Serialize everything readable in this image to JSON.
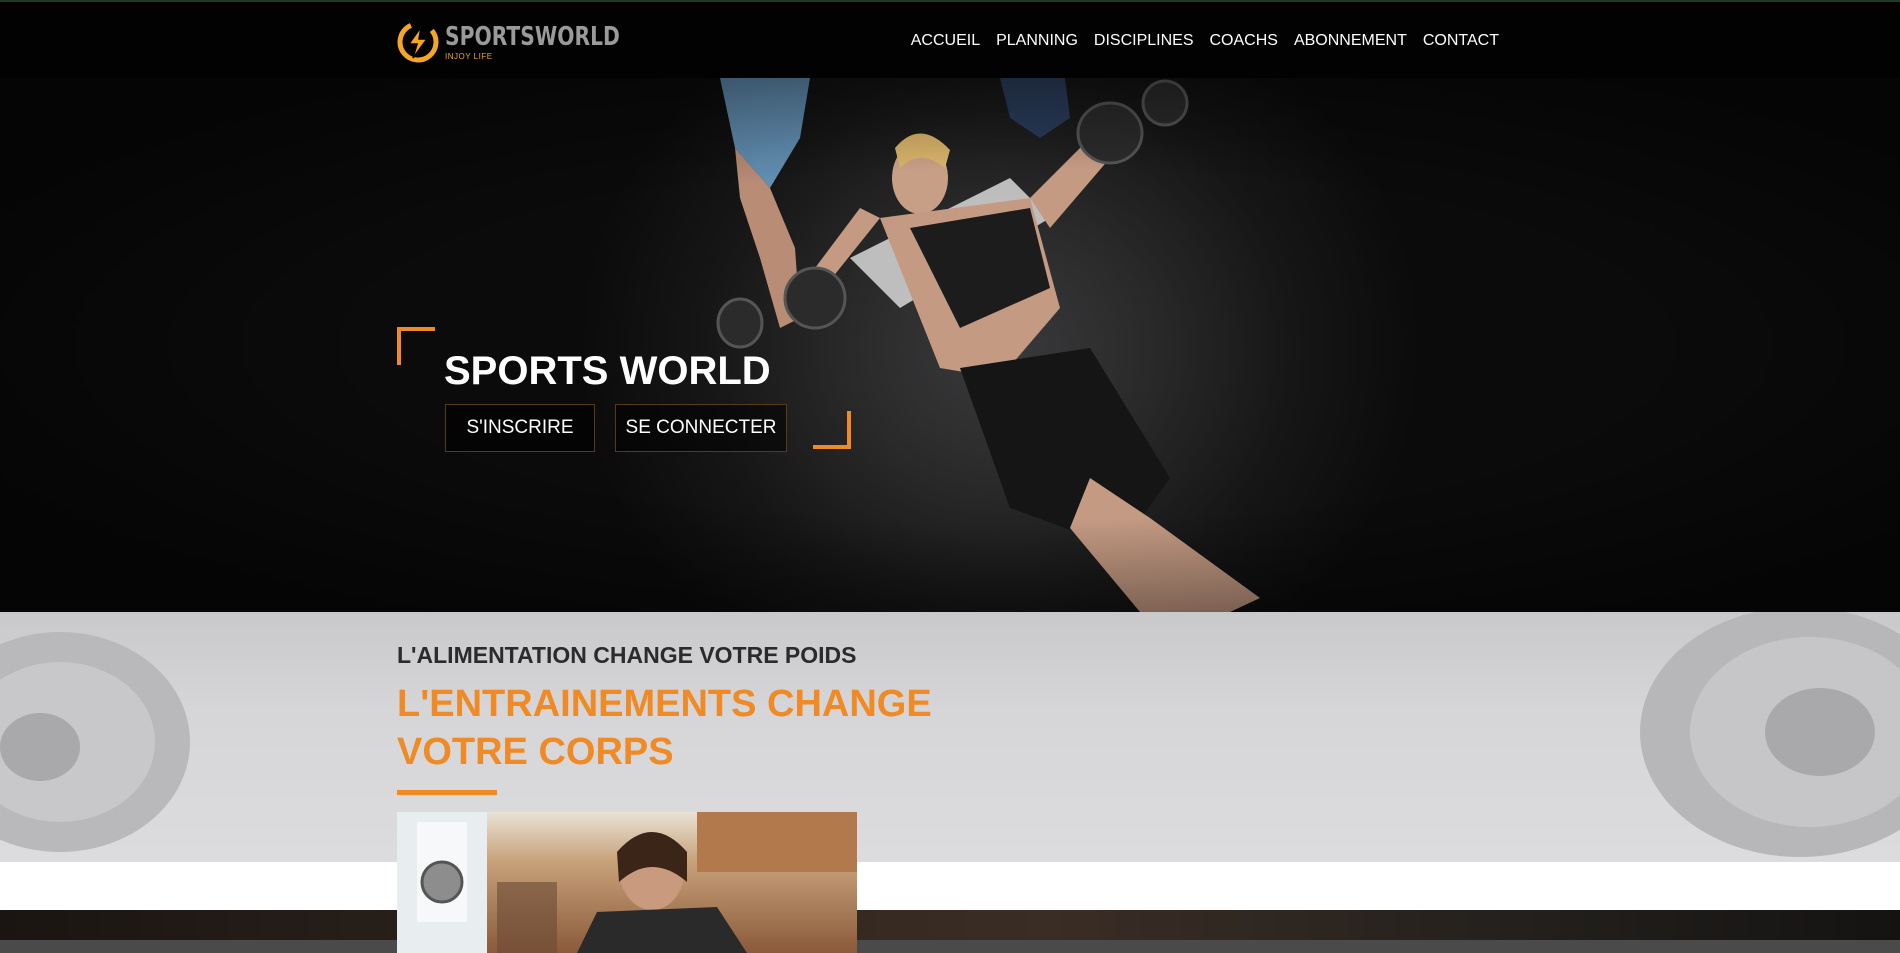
{
  "brand": {
    "name": "SPORTSWORLD",
    "tagline": "INJOY LIFE",
    "logo_icon": "lightning-bolt-icon",
    "accent_color": "#f08a24",
    "logo_color": "#f5a623"
  },
  "nav": {
    "items": [
      {
        "label": "ACCUEIL"
      },
      {
        "label": "PLANNING"
      },
      {
        "label": "DISCIPLINES"
      },
      {
        "label": "COACHS"
      },
      {
        "label": "ABONNEMENT"
      },
      {
        "label": "CONTACT"
      }
    ]
  },
  "hero": {
    "title": "SPORTS WORLD",
    "signup_label": "S'INSCRIRE",
    "login_label": "SE CONNECTER"
  },
  "feature": {
    "subtitle": "L'ALIMENTATION CHANGE VOTRE POIDS",
    "title_line1": "L'ENTRAINEMENTS CHANGE",
    "title_line2": "VOTRE CORPS"
  }
}
